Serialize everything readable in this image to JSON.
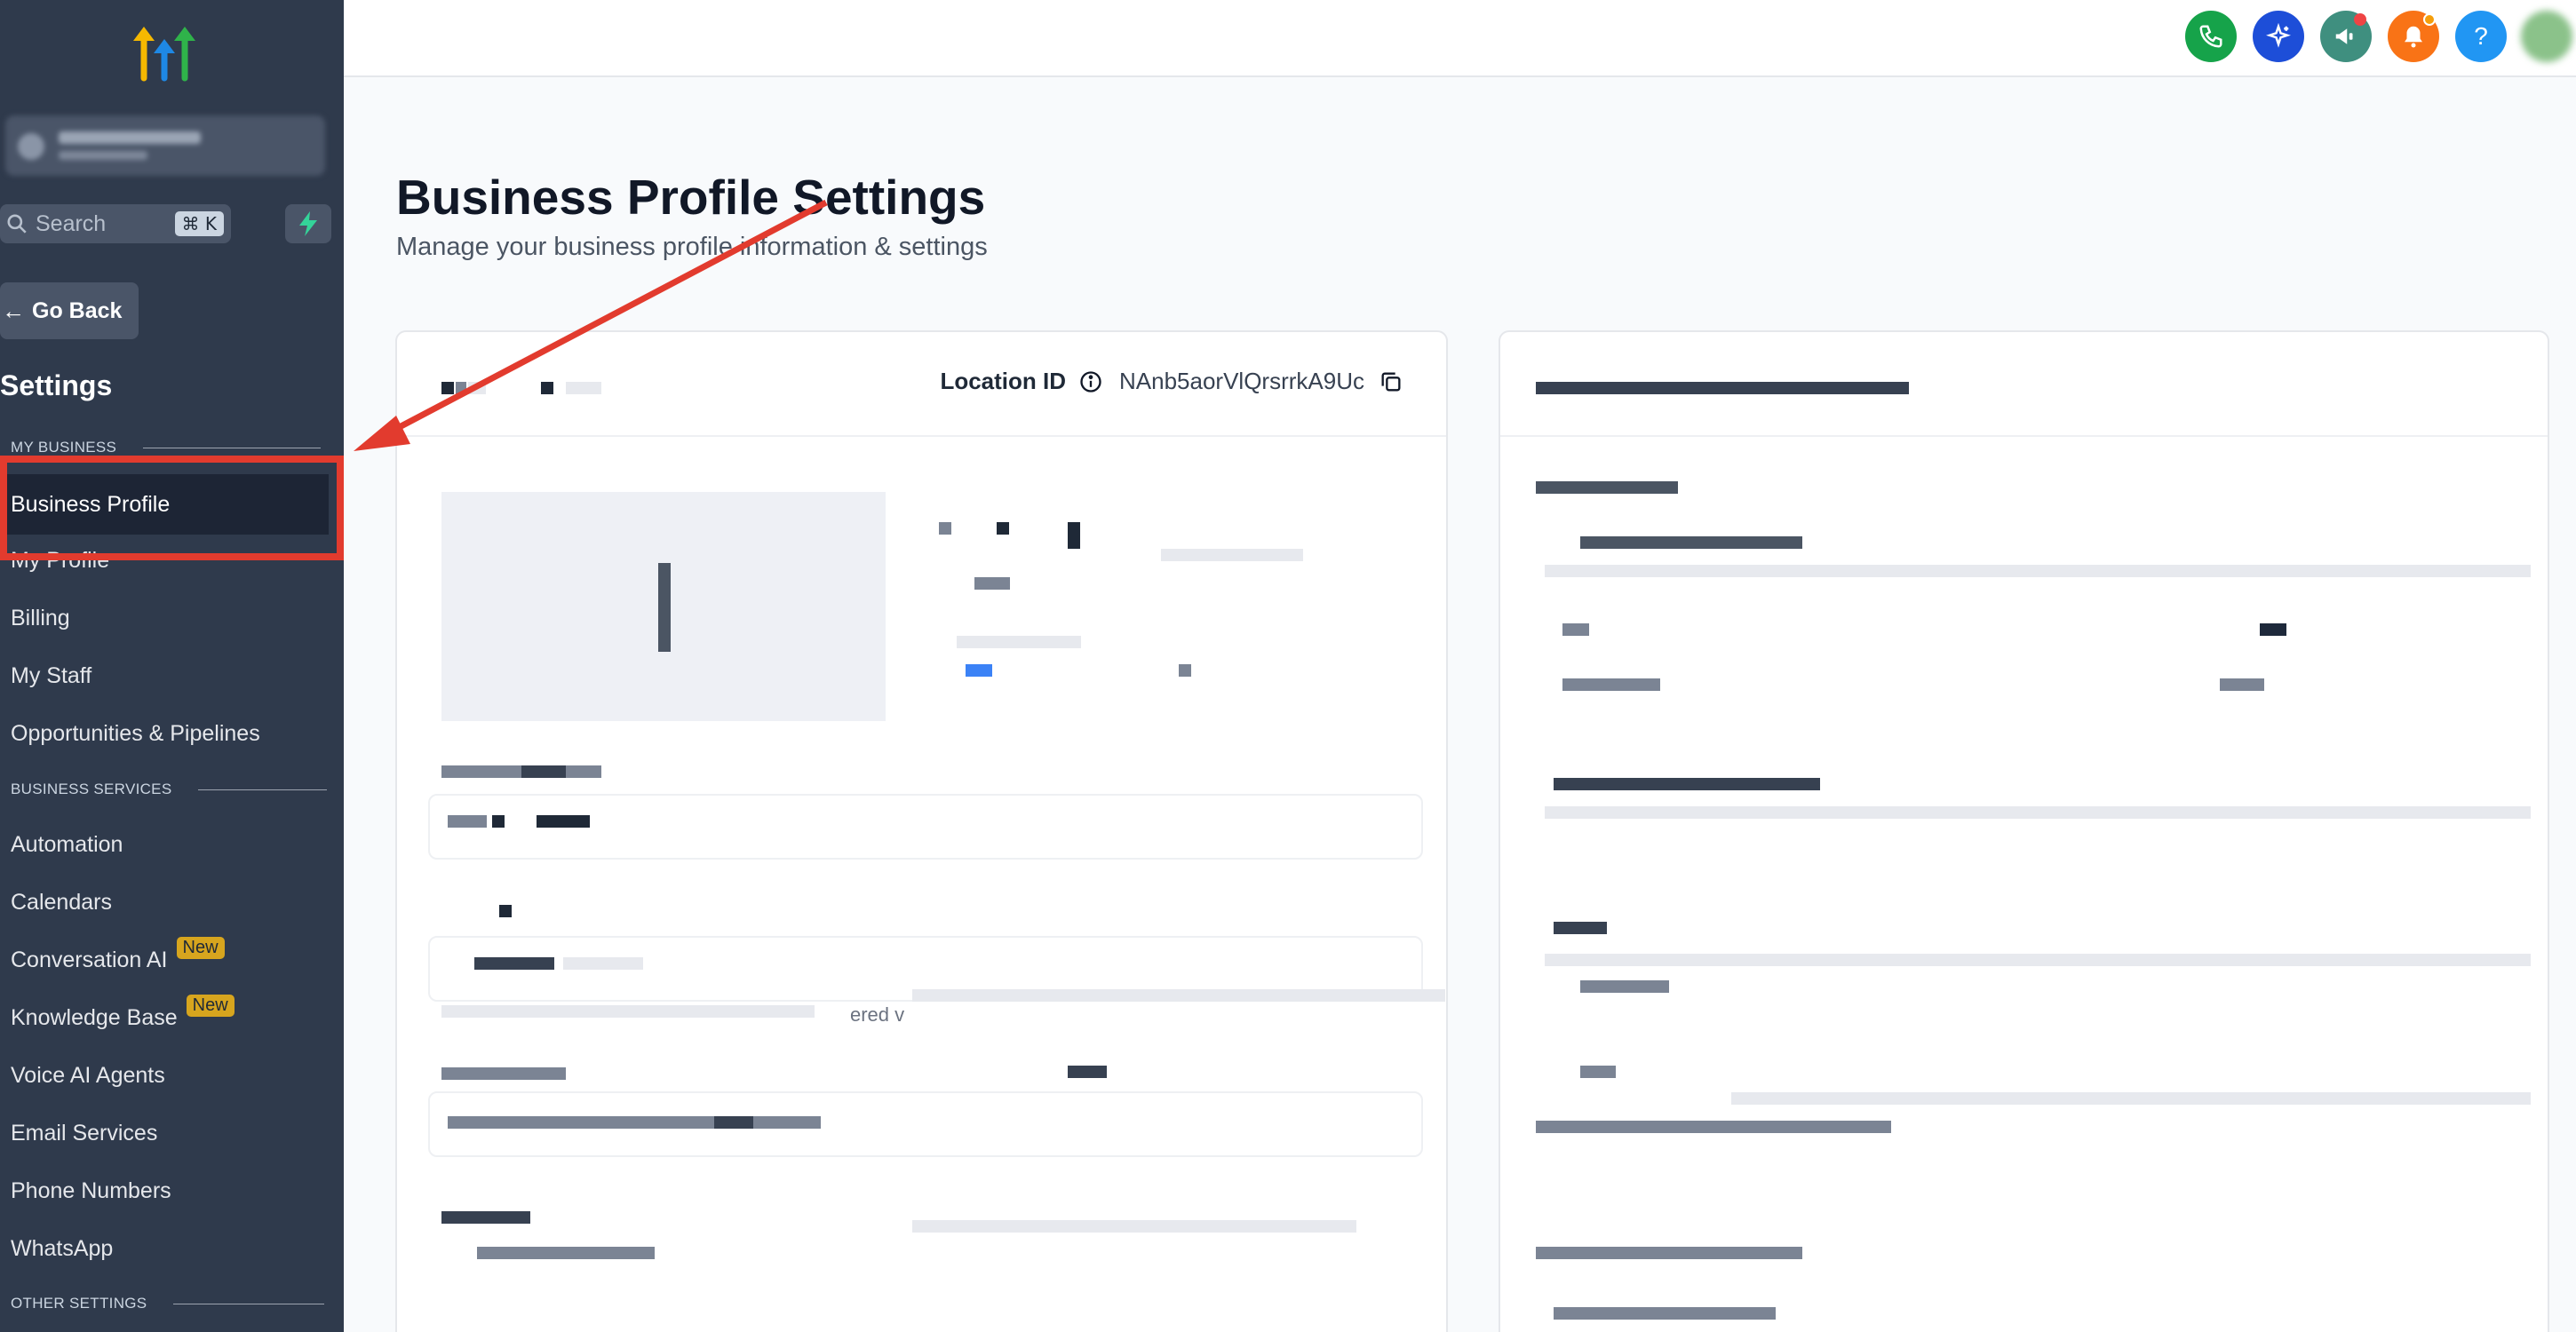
{
  "sidebar": {
    "search": {
      "placeholder": "Search",
      "shortcut": "⌘ K"
    },
    "go_back_label": "Go Back",
    "settings_title": "Settings",
    "section_my_business": "MY BUSINESS",
    "section_business_services": "BUSINESS SERVICES",
    "section_other_settings": "OTHER SETTINGS",
    "items": [
      {
        "label": "Business Profile"
      },
      {
        "label": "My Profile"
      },
      {
        "label": "Billing"
      },
      {
        "label": "My Staff"
      },
      {
        "label": "Opportunities & Pipelines"
      },
      {
        "label": "Automation"
      },
      {
        "label": "Calendars"
      },
      {
        "label": "Conversation AI",
        "badge": "New"
      },
      {
        "label": "Knowledge Base",
        "badge": "New"
      },
      {
        "label": "Voice AI Agents"
      },
      {
        "label": "Email Services"
      },
      {
        "label": "Phone Numbers"
      },
      {
        "label": "WhatsApp"
      }
    ]
  },
  "header": {
    "icons": [
      "phone-icon",
      "ai-sparkle-icon",
      "megaphone-icon",
      "bell-icon",
      "help-icon"
    ],
    "colors": {
      "phone": "#16a34a",
      "ai": "#1d4ed8",
      "megaphone": "#3f8f7f",
      "bell": "#f97316",
      "help": "#2196f3"
    }
  },
  "main": {
    "title": "Business Profile Settings",
    "subtitle": "Manage your business profile information & settings",
    "location_label": "Location ID",
    "location_id": "NAnb5aorVlQrsrrkA9Uc",
    "partial_text": "ered v"
  },
  "colors": {
    "sidebar_bg": "#2f3a4c",
    "active_bg": "#1d2535",
    "annotation": "#e23b2e",
    "badge": "#d7a51e"
  }
}
